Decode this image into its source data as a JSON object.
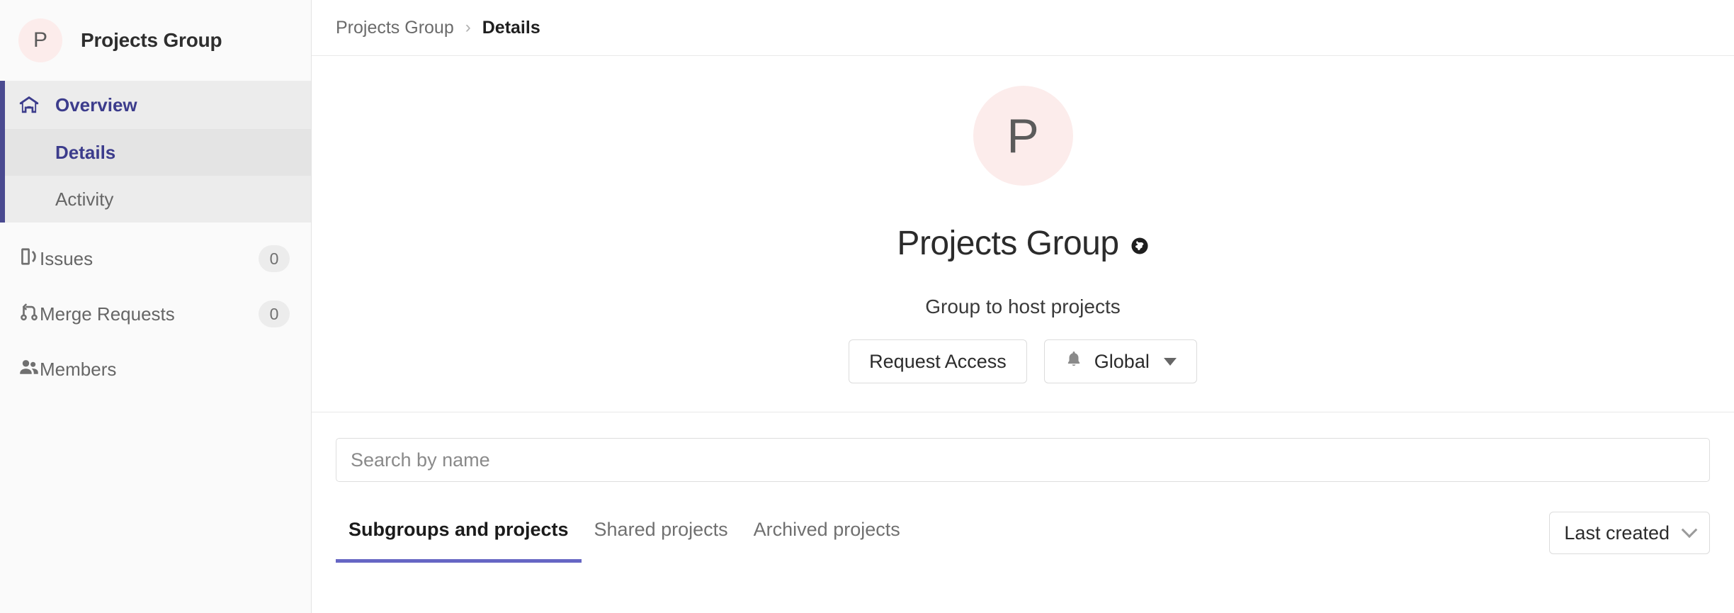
{
  "sidebar": {
    "group_avatar_letter": "P",
    "group_name": "Projects Group",
    "overview": {
      "label": "Overview",
      "icon": "home-icon",
      "subitems": [
        {
          "label": "Details",
          "active": true
        },
        {
          "label": "Activity",
          "active": false
        }
      ]
    },
    "items": [
      {
        "label": "Issues",
        "icon": "issues-icon",
        "count": "0"
      },
      {
        "label": "Merge Requests",
        "icon": "merge-request-icon",
        "count": "0"
      },
      {
        "label": "Members",
        "icon": "members-icon",
        "count": ""
      }
    ]
  },
  "breadcrumb": {
    "root": "Projects Group",
    "separator": "›",
    "current": "Details"
  },
  "group_home": {
    "avatar_letter": "P",
    "title": "Projects Group",
    "visibility_icon": "globe-icon",
    "description": "Group to host projects",
    "request_access_label": "Request Access",
    "notification_label": "Global",
    "notification_icon": "bell-icon"
  },
  "search": {
    "placeholder": "Search by name",
    "value": ""
  },
  "tabs": [
    {
      "label": "Subgroups and projects",
      "active": true
    },
    {
      "label": "Shared projects",
      "active": false
    },
    {
      "label": "Archived projects",
      "active": false
    }
  ],
  "sort": {
    "label": "Last created",
    "icon": "chevron-down-icon"
  },
  "colors": {
    "accent_purple": "#6666c4",
    "sidebar_accent": "#4a4a90",
    "avatar_bg": "#fceceb",
    "link_indigo": "#3c3c8c"
  }
}
